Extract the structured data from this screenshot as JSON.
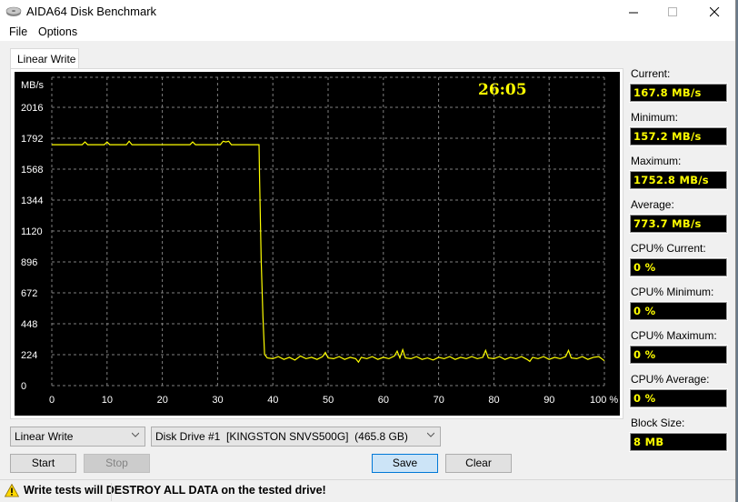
{
  "window": {
    "title": "AIDA64 Disk Benchmark",
    "icon": "disk-drive-icon",
    "controls": [
      "minimize",
      "maximize",
      "close"
    ]
  },
  "menu": [
    "File",
    "Options"
  ],
  "tabs": [
    {
      "label": "Linear Write",
      "active": true
    }
  ],
  "chart": {
    "timer": "26:05",
    "y_unit_label": "MB/s",
    "y_ticks": [
      "2016",
      "1792",
      "1568",
      "1344",
      "1120",
      "896",
      "672",
      "448",
      "224",
      "0"
    ],
    "x_ticks": [
      "0",
      "10",
      "20",
      "30",
      "40",
      "50",
      "60",
      "70",
      "80",
      "90",
      "100 %"
    ],
    "colors": {
      "background": "#000000",
      "line": "#ffff00",
      "grid": "#808080",
      "text": "#ffffff",
      "timer": "#ffff00"
    }
  },
  "chart_data": {
    "type": "line",
    "title": "Linear Write",
    "xlabel": "%",
    "ylabel": "MB/s",
    "xlim": [
      0,
      100
    ],
    "ylim": [
      0,
      2240
    ],
    "grid": true,
    "series": [
      {
        "name": "Linear Write",
        "points": [
          [
            0,
            1745
          ],
          [
            5.5,
            1745
          ],
          [
            6,
            1765
          ],
          [
            6.5,
            1745
          ],
          [
            9.5,
            1745
          ],
          [
            10,
            1765
          ],
          [
            10.5,
            1745
          ],
          [
            13.5,
            1745
          ],
          [
            14,
            1770
          ],
          [
            14.5,
            1745
          ],
          [
            25,
            1745
          ],
          [
            25.5,
            1765
          ],
          [
            26,
            1745
          ],
          [
            30.5,
            1745
          ],
          [
            31,
            1770
          ],
          [
            31.5,
            1765
          ],
          [
            32,
            1770
          ],
          [
            32.5,
            1745
          ],
          [
            37.5,
            1745
          ],
          [
            37.6,
            1500
          ],
          [
            37.9,
            900
          ],
          [
            38.2,
            500
          ],
          [
            38.5,
            225
          ],
          [
            39,
            200
          ],
          [
            40,
            195
          ],
          [
            41,
            210
          ],
          [
            42,
            190
          ],
          [
            43,
            205
          ],
          [
            44,
            185
          ],
          [
            45,
            215
          ],
          [
            46,
            195
          ],
          [
            47,
            205
          ],
          [
            48,
            190
          ],
          [
            49,
            210
          ],
          [
            49.5,
            240
          ],
          [
            50,
            200
          ],
          [
            51,
            195
          ],
          [
            52,
            210
          ],
          [
            53,
            190
          ],
          [
            54,
            205
          ],
          [
            55,
            195
          ],
          [
            55.5,
            170
          ],
          [
            56,
            205
          ],
          [
            57,
            195
          ],
          [
            58,
            210
          ],
          [
            59,
            190
          ],
          [
            60,
            205
          ],
          [
            61,
            195
          ],
          [
            62,
            215
          ],
          [
            62.5,
            250
          ],
          [
            63,
            200
          ],
          [
            63.5,
            260
          ],
          [
            64,
            200
          ],
          [
            65,
            195
          ],
          [
            66,
            210
          ],
          [
            67,
            190
          ],
          [
            68,
            200
          ],
          [
            69,
            185
          ],
          [
            70,
            205
          ],
          [
            71,
            195
          ],
          [
            72,
            210
          ],
          [
            73,
            190
          ],
          [
            74,
            205
          ],
          [
            75,
            195
          ],
          [
            76,
            210
          ],
          [
            77,
            195
          ],
          [
            78,
            205
          ],
          [
            78.5,
            255
          ],
          [
            79,
            200
          ],
          [
            80,
            195
          ],
          [
            81,
            210
          ],
          [
            82,
            190
          ],
          [
            83,
            205
          ],
          [
            84,
            195
          ],
          [
            85,
            210
          ],
          [
            86,
            190
          ],
          [
            86.5,
            175
          ],
          [
            87,
            205
          ],
          [
            88,
            195
          ],
          [
            89,
            210
          ],
          [
            90,
            190
          ],
          [
            91,
            205
          ],
          [
            92,
            195
          ],
          [
            93,
            210
          ],
          [
            93.5,
            255
          ],
          [
            94,
            200
          ],
          [
            95,
            195
          ],
          [
            96,
            210
          ],
          [
            97,
            190
          ],
          [
            98,
            205
          ],
          [
            99,
            210
          ],
          [
            100,
            180
          ]
        ]
      }
    ]
  },
  "stats": [
    {
      "label": "Current:",
      "value": "167.8 MB/s"
    },
    {
      "label": "Minimum:",
      "value": "157.2 MB/s"
    },
    {
      "label": "Maximum:",
      "value": "1752.8 MB/s"
    },
    {
      "label": "Average:",
      "value": "773.7 MB/s"
    },
    {
      "label": "CPU% Current:",
      "value": "0 %"
    },
    {
      "label": "CPU% Minimum:",
      "value": "0 %"
    },
    {
      "label": "CPU% Maximum:",
      "value": "0 %"
    },
    {
      "label": "CPU% Average:",
      "value": "0 %"
    },
    {
      "label": "Block Size:",
      "value": "8 MB"
    }
  ],
  "controls": {
    "test_select": "Linear Write",
    "drive_select": "Disk Drive #1  [KINGSTON SNVS500G]  (465.8 GB)",
    "start_label": "Start",
    "stop_label": "Stop",
    "save_label": "Save",
    "clear_label": "Clear"
  },
  "status": {
    "warning_icon": "warning-icon",
    "warning_text": "Write tests will DESTROY ALL DATA on the tested drive!"
  }
}
